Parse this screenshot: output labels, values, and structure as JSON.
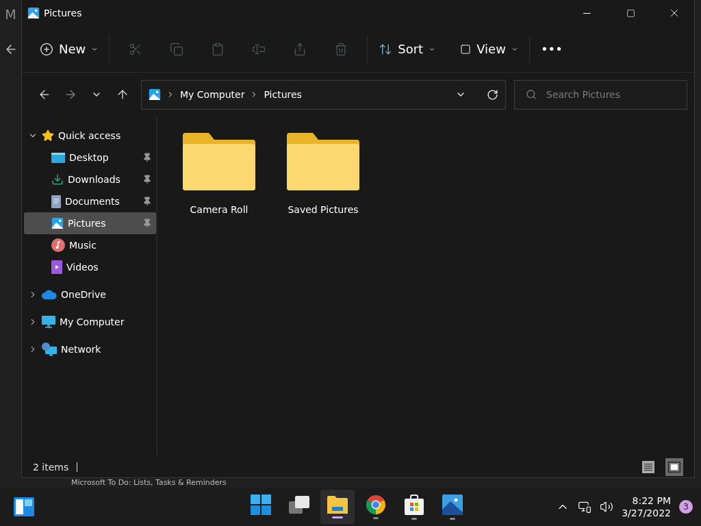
{
  "background_app": {
    "title": "M",
    "list_item": "Microsoft To Do: Lists, Tasks & Reminders"
  },
  "window": {
    "title": "Pictures"
  },
  "toolbar": {
    "new": "New",
    "actions": [
      {
        "kind": "cut",
        "disabled": true
      },
      {
        "kind": "copy",
        "disabled": true
      },
      {
        "kind": "paste",
        "disabled": true
      },
      {
        "kind": "rename",
        "disabled": true
      },
      {
        "kind": "share",
        "disabled": true
      },
      {
        "kind": "delete",
        "disabled": true
      }
    ],
    "sort": "Sort",
    "view": "View",
    "more": "•••"
  },
  "address_bar": {
    "path": [
      "My Computer",
      "Pictures"
    ]
  },
  "search": {
    "placeholder": "Search Pictures"
  },
  "nav": {
    "items": [
      {
        "label": "Quick access",
        "expanded": true,
        "selected": false,
        "children": [
          {
            "label": "Desktop",
            "pinned": true,
            "selected": false
          },
          {
            "label": "Downloads",
            "pinned": true,
            "selected": false
          },
          {
            "label": "Documents",
            "pinned": true,
            "selected": false
          },
          {
            "label": "Pictures",
            "pinned": true,
            "selected": true
          },
          {
            "label": "Music",
            "pinned": false,
            "selected": false
          },
          {
            "label": "Videos",
            "pinned": false,
            "selected": false
          }
        ]
      },
      {
        "label": "OneDrive",
        "expanded": false,
        "selected": false
      },
      {
        "label": "My Computer",
        "expanded": false,
        "selected": false
      },
      {
        "label": "Network",
        "expanded": false,
        "selected": false
      }
    ]
  },
  "folders": [
    {
      "name": "Camera Roll"
    },
    {
      "name": "Saved Pictures"
    }
  ],
  "status_bar": {
    "count": "2 items",
    "layouts": [
      {
        "kind": "details",
        "selected": false
      },
      {
        "kind": "tiles",
        "selected": true
      }
    ]
  },
  "taskbar": {
    "apps": [
      {
        "kind": "start",
        "running": false,
        "selected": false
      },
      {
        "kind": "taskview",
        "running": false,
        "selected": false
      },
      {
        "kind": "explorer",
        "running": true,
        "selected": true
      },
      {
        "kind": "chrome",
        "running": true,
        "selected": false
      },
      {
        "kind": "store",
        "running": true,
        "selected": false
      },
      {
        "kind": "photos",
        "running": true,
        "selected": false
      }
    ],
    "time": "8:22 PM",
    "date": "3/27/2022",
    "notifications": "3"
  }
}
